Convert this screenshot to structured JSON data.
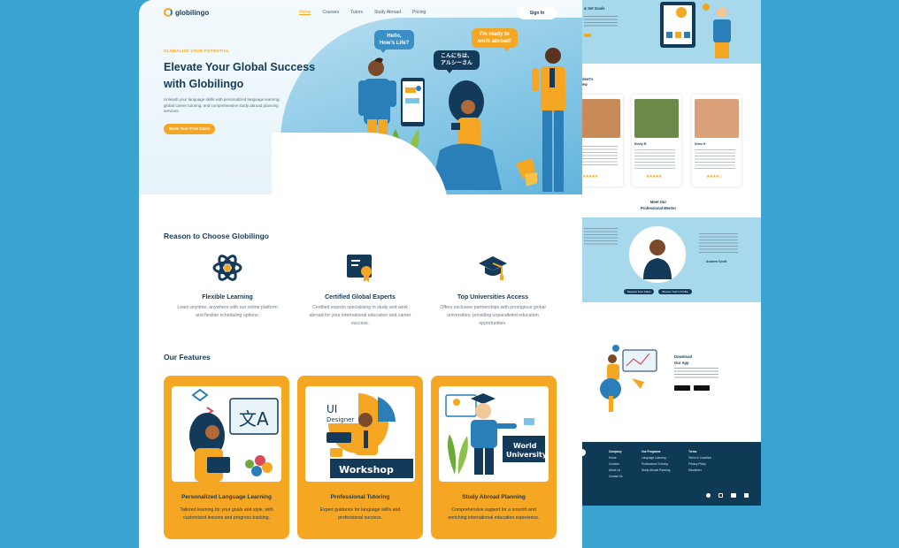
{
  "nav": {
    "logo": "globilingo",
    "links": [
      "Home",
      "Courses",
      "Tutors",
      "Study Abroad",
      "Pricing"
    ],
    "signin": "Sign In"
  },
  "hero": {
    "eyebrow": "GLOBALIZE YOUR POTENTIAL",
    "title": "Elevate Your Global Success with Globilingo",
    "subtitle": "Unleash your language skills with personalized language learning, global career tutoring, and comprehensive study abroad planning services.",
    "cta": "Book Your Free Class",
    "bubbles": [
      "Hello, How's Life?",
      "こんにちは、アルシーさん",
      "I'm ready to work abroad!"
    ]
  },
  "reasons": {
    "title": "Reason to Choose Globilingo",
    "items": [
      {
        "title": "Flexible Learning",
        "desc": "Learn anytime, anywhere with our online platform and flexible scheduling options."
      },
      {
        "title": "Certified Global Experts",
        "desc": "Certified experts specialising in study and work abroad for your international education and career success."
      },
      {
        "title": "Top Universities Access",
        "desc": "Offers exclusive partnerships with prestigious global universities, providing unparalleled education opportunities."
      }
    ]
  },
  "features": {
    "title": "Our Features",
    "items": [
      {
        "title": "Personalized Language Learning",
        "desc": "Tailored learning for your goals and style, with customized lessons and progress tracking."
      },
      {
        "title": "Professional Tutoring",
        "desc": "Expert guidance for language skills and professional success.",
        "img_text1": "UI",
        "img_text2": "Designer",
        "img_text3": "Workshop"
      },
      {
        "title": "Study Abroad Planning",
        "desc": "Comprehensive support for a smooth and enriching international education experience.",
        "img_text1": "World",
        "img_text2": "University"
      }
    ]
  },
  "preview": {
    "top_title": "& Set Goals",
    "students_title1": "dent's",
    "students_title2": "ew",
    "card_names": [
      "Emily R.",
      "Drive K"
    ],
    "mentor_title1": "Meet Our",
    "mentor_title2": "Professional Mentor",
    "mentor_btn1": "Request Free Class",
    "mentor_btn2": "Browse Tutor's Profile",
    "mentor_name": "Andrew Scott",
    "app_title1": "Download",
    "app_title2": "Our App",
    "footer_cols": [
      {
        "title": "Company",
        "items": [
          "Home",
          "Courses",
          "About Us",
          "Contact Us"
        ]
      },
      {
        "title": "Our Programs",
        "items": [
          "Language Learning",
          "Professional Tutoring",
          "Study Abroad Planning"
        ]
      },
      {
        "title": "Terms",
        "items": [
          "Terms & Condition",
          "Privacy Policy",
          "Disclaimer"
        ]
      }
    ]
  },
  "colors": {
    "accent": "#f5a623",
    "navy": "#143a5a",
    "sky": "#3aa3cf"
  }
}
